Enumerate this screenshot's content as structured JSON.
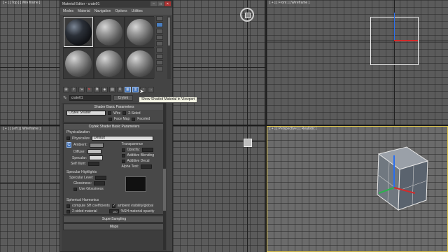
{
  "viewports": {
    "top": "[ + ] [ Top ] [ Wireframe ]",
    "front": "[ + ] [ Front ] [ Wireframe ]",
    "left": "[ + ] [ Left ] [ Wireframe ]",
    "perspective": "[ + ] [ Perspective ] [ Realistic ]"
  },
  "material_editor": {
    "title": "Material Editor - crate01",
    "window_buttons": [
      "–",
      "□",
      "×"
    ],
    "menu": [
      "Modes",
      "Material",
      "Navigation",
      "Options",
      "Utilities"
    ],
    "material_name": "crate01",
    "type_button": "Crytek",
    "tooltip": "Show Shaded Material in Viewport"
  },
  "shader_basic": {
    "header": "Shader Basic Parameters",
    "shader": "Crytek Shader",
    "wire": "Wire",
    "two_sided": "2-Sided",
    "face_map": "Face Map",
    "faceted": "Faceted"
  },
  "crytek_basic": {
    "header": "Crytek Shader Basic Parameters",
    "physicalization_group": "Physicalization",
    "physicalize_label": "Physicalize",
    "physicalize_value": "Default",
    "lock_letter": "C",
    "ambient": "Ambient:",
    "diffuse": "Diffuse:",
    "specular": "Specular:",
    "self_illum": "Self Illum:",
    "transparence_group": "Transparence",
    "opacity": "Opacity:",
    "additive_blending": "Additive Blending",
    "additive_decal": "Additive Decal",
    "alpha_test": "Alpha Test:",
    "specular_highlights": "Specular Highlights",
    "specular_level": "Specular Level:",
    "glossiness": "Glossiness:",
    "use_glossiness": "Use Glossiness",
    "spherical_harmonics": "Spherical Harmonics",
    "compute_sh": "compute SH coefficients",
    "ambient_visibility": "ambient visibility/global",
    "two_sided_material": "2-sided material",
    "sh_value": "100",
    "sh_opacity": "%SH material opacity"
  },
  "rollouts": {
    "supersampling": "SuperSampling",
    "maps": "Maps"
  }
}
